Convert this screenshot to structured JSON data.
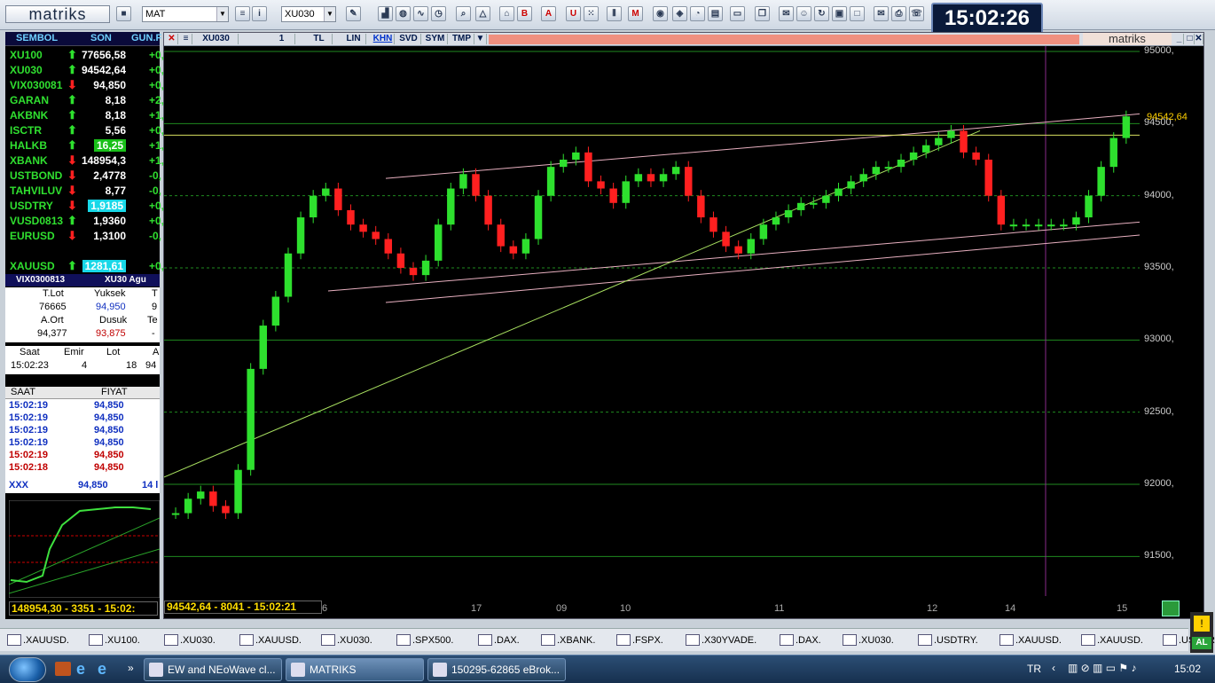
{
  "app": {
    "logo": "matriks",
    "clock": "15:02:26"
  },
  "toolbar": {
    "template_value": "MAT",
    "symbol_value": "XU030"
  },
  "watchlist": {
    "headers": {
      "symbol": "SEMBOL",
      "last": "SON",
      "change": "GUN.F"
    },
    "rows": [
      {
        "symbol": "XU100",
        "dir": "up",
        "last": "77656,58",
        "change": "+0,"
      },
      {
        "symbol": "XU030",
        "dir": "up",
        "last": "94542,64",
        "change": "+0,"
      },
      {
        "symbol": "VIX030081",
        "dir": "down",
        "last": "94,850",
        "change": "+0,"
      },
      {
        "symbol": "GARAN",
        "dir": "up",
        "last": "8,18",
        "change": "+2,"
      },
      {
        "symbol": "AKBNK",
        "dir": "up",
        "last": "8,18",
        "change": "+1,"
      },
      {
        "symbol": "ISCTR",
        "dir": "up",
        "last": "5,56",
        "change": "+0,"
      },
      {
        "symbol": "HALKB",
        "dir": "up",
        "last": "16,25",
        "change": "+1,",
        "hl": "#19c019"
      },
      {
        "symbol": "XBANK",
        "dir": "down",
        "last": "148954,3",
        "change": "+1,"
      },
      {
        "symbol": "USTBOND",
        "dir": "down",
        "last": "2,4778",
        "change": "-0,"
      },
      {
        "symbol": "TAHVILUV",
        "dir": "down",
        "last": "8,77",
        "change": "-0,"
      },
      {
        "symbol": "USDTRY",
        "dir": "down",
        "last": "1,9185",
        "change": "+0,",
        "hl": "#18d8e8"
      },
      {
        "symbol": "VUSD0813",
        "dir": "up",
        "last": "1,9360",
        "change": "+0,"
      },
      {
        "symbol": "EURUSD",
        "dir": "down",
        "last": "1,3100",
        "change": "-0,"
      },
      {
        "symbol": "XAUUSD",
        "dir": "up",
        "last": "1281,61",
        "change": "+0,",
        "hl": "#18d8e8"
      }
    ]
  },
  "detail": {
    "title": "VIX0300813",
    "subtitle": "XU30 Agu",
    "h1": [
      "T.Lot",
      "Yuksek",
      "T"
    ],
    "v1": [
      "76665",
      "94,950",
      "9"
    ],
    "h2": [
      "A.Ort",
      "Dusuk",
      "Te"
    ],
    "v2": [
      "94,377",
      "93,875",
      "-"
    ],
    "h3": [
      "Saat",
      "Emir",
      "Lot",
      "A"
    ],
    "v3": [
      "15:02:23",
      "4",
      "18",
      "94"
    ]
  },
  "trades": {
    "headers": [
      "SAAT",
      "FIYAT"
    ],
    "rows": [
      {
        "time": "15:02:19",
        "price": "94,850",
        "side": "buy"
      },
      {
        "time": "15:02:19",
        "price": "94,850",
        "side": "buy"
      },
      {
        "time": "15:02:19",
        "price": "94,850",
        "side": "buy"
      },
      {
        "time": "15:02:19",
        "price": "94,850",
        "side": "buy"
      },
      {
        "time": "15:02:19",
        "price": "94,850",
        "side": "sell"
      },
      {
        "time": "15:02:18",
        "price": "94,850",
        "side": "sell"
      }
    ],
    "summary": {
      "symbol": "XXX",
      "price": "94,850",
      "lot": "14 l"
    }
  },
  "left_status": "148954,30 - 3351 - 15:02:",
  "chart": {
    "symbol": "XU030",
    "period": "1",
    "buttons": [
      "TL",
      "LIN",
      "KHN",
      "SVD",
      "SYM",
      "TMP"
    ],
    "active": "KHN",
    "status": "94542,64 - 8041 - 15:02:21",
    "current_price": "94542,64",
    "price_labels": [
      "95000,",
      "94500,",
      "94000,",
      "93500,",
      "93000,",
      "92500,",
      "92000,",
      "91500,"
    ],
    "x_labels": [
      "6",
      "17",
      "09",
      "10",
      "11",
      "12",
      "14",
      "15"
    ]
  },
  "chart_data": {
    "type": "line",
    "ylim": [
      91250,
      95000
    ],
    "x_labels": [
      "6",
      "17",
      "09",
      "10",
      "11",
      "12",
      "14",
      "15"
    ],
    "series": [
      {
        "values": [
          91800,
          91900,
          91950,
          91850,
          91800,
          92100,
          92800,
          93100,
          93300,
          93600,
          93850,
          94000,
          94050,
          93900,
          93800,
          93750,
          93700,
          93600,
          93500,
          93450,
          93550,
          93800,
          94050,
          94150,
          94000,
          93800,
          93650,
          93600,
          93700,
          94000,
          94200,
          94250,
          94300,
          94100,
          94050,
          93950,
          94100,
          94150,
          94100,
          94150,
          94200,
          94000,
          93850,
          93750,
          93650,
          93600,
          93700,
          93800,
          93850,
          93900,
          93950,
          93950,
          94000,
          94050,
          94100,
          94150,
          94200,
          94200,
          94250,
          94300,
          94350,
          94400,
          94450,
          94300,
          94250,
          94000,
          93800,
          93800,
          93800,
          93800,
          93800,
          93800,
          93850,
          94000,
          94200,
          94400,
          94550
        ]
      }
    ]
  },
  "tabs": [
    ".XAUUSD.",
    ".XU100.",
    ".XU030.",
    ".XAUUSD.",
    ".XU030.",
    ".SPX500.",
    ".DAX.",
    ".XBANK.",
    ".FSPX.",
    ".X30YVADE.",
    ".DAX.",
    ".XU030.",
    ".USDTRY.",
    ".XAUUSD.",
    ".XAUUSD.",
    ".USDTRY."
  ],
  "taskbar": {
    "items": [
      "EW and NEoWave cl...",
      "MATRIKS",
      "150295-62865 eBrok..."
    ],
    "lang": "TR",
    "time": "15:02"
  },
  "colors": {
    "up": "#2ee02e",
    "down": "#ff2020",
    "grid": "#1f8a1f",
    "trend": "#e8b0c0",
    "background": "#000000",
    "highlight": "#ffd000"
  }
}
